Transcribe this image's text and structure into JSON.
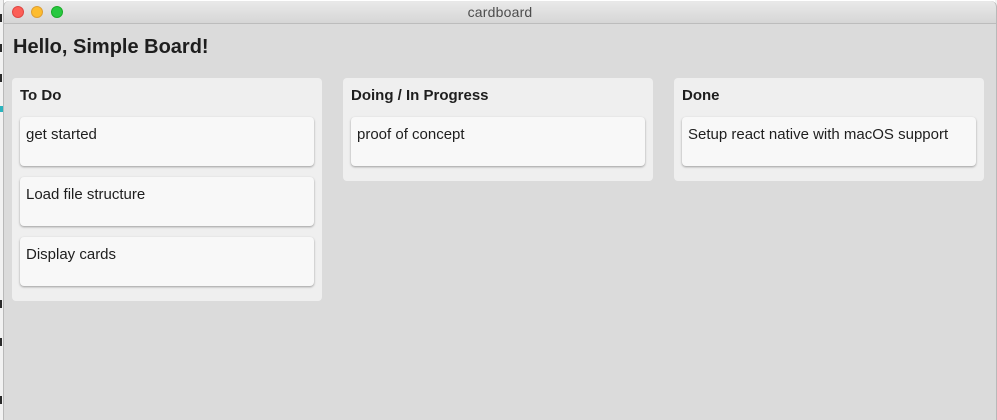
{
  "window": {
    "title": "cardboard"
  },
  "app": {
    "heading": "Hello, Simple Board!"
  },
  "columns": [
    {
      "title": "To Do",
      "cards": [
        "get started",
        "Load file structure",
        "Display cards"
      ]
    },
    {
      "title": "Doing / In Progress",
      "cards": [
        "proof of concept"
      ]
    },
    {
      "title": "Done",
      "cards": [
        "Setup react native with macOS support"
      ]
    }
  ],
  "colors": {
    "window_background": "#dbdbdb",
    "column_background": "#efefef",
    "card_background": "#f8f8f8",
    "close_button": "#fc5f57",
    "minimize_button": "#fdbc2e",
    "zoom_button": "#28c840"
  }
}
